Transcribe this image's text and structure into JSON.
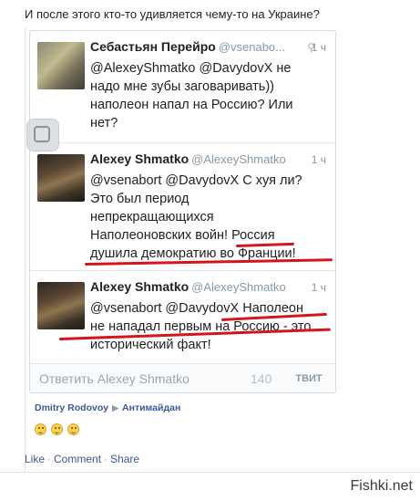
{
  "post": {
    "text": "И после этого кто-то удивляется чему-то на Украине?"
  },
  "tweets": [
    {
      "name": "Себастьян   Перейро",
      "handle": "@vsenabo...",
      "time": "1 ч",
      "lines": [
        "@AlexeyShmatko @DavydovX не",
        "надо мне зубы заговаривать))",
        "наполеон напал на Россию? Или",
        "нет?"
      ]
    },
    {
      "name": "Alexey Shmatko",
      "handle": "@AlexeyShmatko",
      "time": "1 ч",
      "lines": [
        "@vsenabort @DavydovX  С хуя ли?",
        "Это был период",
        "непрекращающихся",
        "Наполеоновских войн! Россия",
        "душила демократию во Франции!"
      ]
    },
    {
      "name": "Alexey Shmatko",
      "handle": "@AlexeyShmatko",
      "time": "1 ч",
      "lines": [
        "@vsenabort @DavydovX Наполеон",
        "не нападал первым на Россию - это",
        "исторический факт!"
      ]
    }
  ],
  "reply": {
    "placeholder": "Ответить Alexey Shmatko",
    "count": "140",
    "button": "ТВИТ"
  },
  "group": {
    "author": "Dmitry  Rodovoy",
    "name": "Антимайдан"
  },
  "actions": {
    "like": "Like",
    "comment": "Comment",
    "share": "Share",
    "sep": "·"
  },
  "watermark": "Fishki.net",
  "accent": {
    "underline": "#d4151b",
    "link": "#3b5998"
  }
}
